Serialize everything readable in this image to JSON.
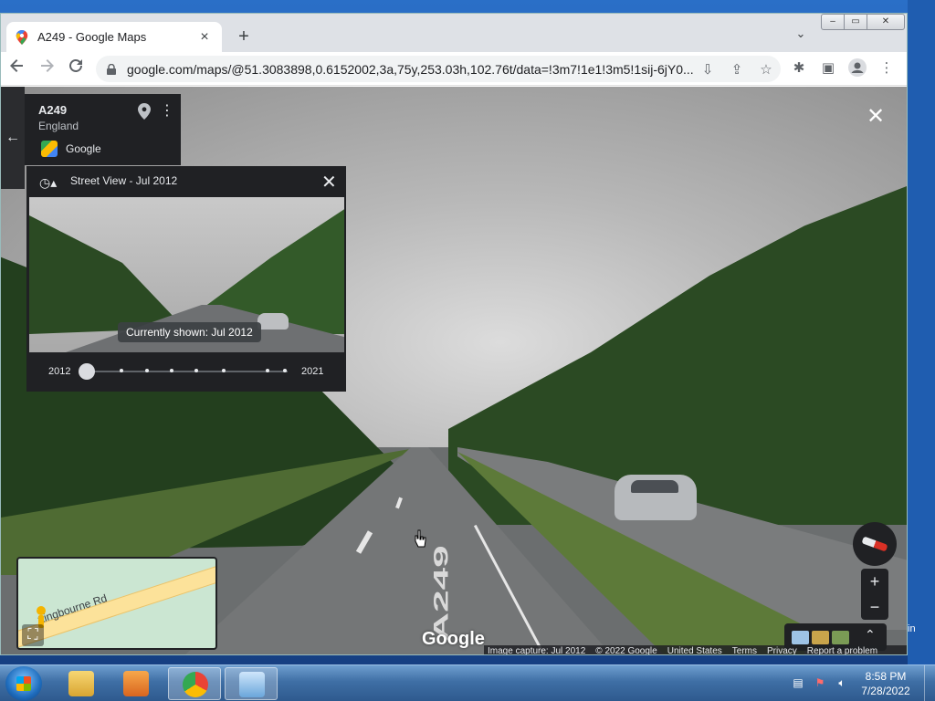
{
  "browser": {
    "tab_title": "A249 - Google Maps",
    "tab_close": "×",
    "new_tab": "+",
    "tab_search": "⌄",
    "url": "google.com/maps/@51.3083898,0.6152002,3a,75y,253.03h,102.76t/data=!3m7!1e1!3m5!1sij-6jY0...",
    "window_controls": {
      "minimize": "–",
      "maximize": "▭",
      "close": "✕"
    }
  },
  "place": {
    "title": "A249",
    "subtitle": "England",
    "brand": "Google"
  },
  "time_machine": {
    "title": "Street View - Jul 2012",
    "tooltip": "Currently shown: Jul 2012",
    "year_start": "2012",
    "year_end": "2021",
    "available_dates": 8,
    "selected_index": 0
  },
  "minimap": {
    "road_label": "ttingbourne Rd"
  },
  "map_brand": "Google",
  "road_marking": "A249",
  "footer": {
    "capture": "Image capture: Jul 2012",
    "copyright": "© 2022 Google",
    "region": "United States",
    "terms": "Terms",
    "privacy": "Privacy",
    "report": "Report a problem"
  },
  "zoom": {
    "in": "+",
    "out": "−"
  },
  "edge_text": "in",
  "taskbar": {
    "time": "8:58 PM",
    "date": "7/28/2022"
  },
  "colors": {
    "maps_panel": "#202124",
    "accent_red": "#d93025",
    "taskbar": "#3f6fa5"
  }
}
